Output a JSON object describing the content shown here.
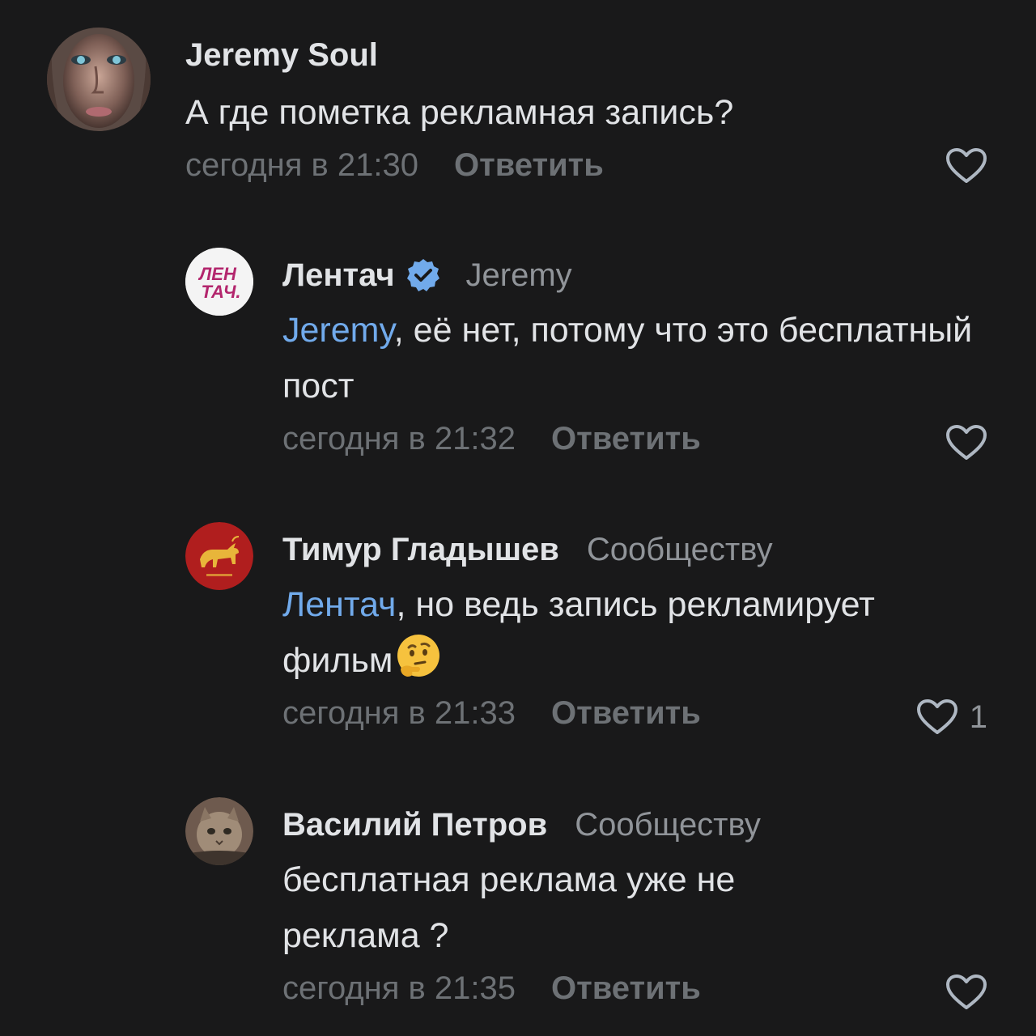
{
  "comments": [
    {
      "author": "Jeremy Soul",
      "text": "А где пометка рекламная запись?",
      "date": "сегодня в 21:30",
      "reply_label": "Ответить",
      "avatar_icon": "woman-portrait-avatar"
    },
    {
      "author": "Лентач",
      "verified": true,
      "reply_to": "Jeremy",
      "mention": "Jeremy",
      "text_rest": ", её нет, потому что это бесплатный пост",
      "date": "сегодня в 21:32",
      "reply_label": "Ответить",
      "avatar_logo": [
        "ЛЕН",
        "ТАЧ."
      ]
    },
    {
      "author": "Тимур Гладышев",
      "reply_to": "Сообществу",
      "mention": "Лентач",
      "text_rest": ", но ведь запись рекламирует фильм",
      "emoji": "thinking-face",
      "date": "сегодня в 21:33",
      "reply_label": "Ответить",
      "like_count": "1",
      "avatar_icon": "bull-emblem-avatar"
    },
    {
      "author": "Василий Петров",
      "reply_to": "Сообществу",
      "text": "бесплатная реклама уже не реклама ?",
      "date": "сегодня в 21:35",
      "reply_label": "Ответить",
      "avatar_icon": "cat-photo-avatar"
    }
  ],
  "colors": {
    "background": "#19191a",
    "text": "#e1e3e6",
    "secondary": "#909499",
    "meta": "#6d7175",
    "accent": "#71aaeb",
    "verified": "#71aaeb"
  }
}
